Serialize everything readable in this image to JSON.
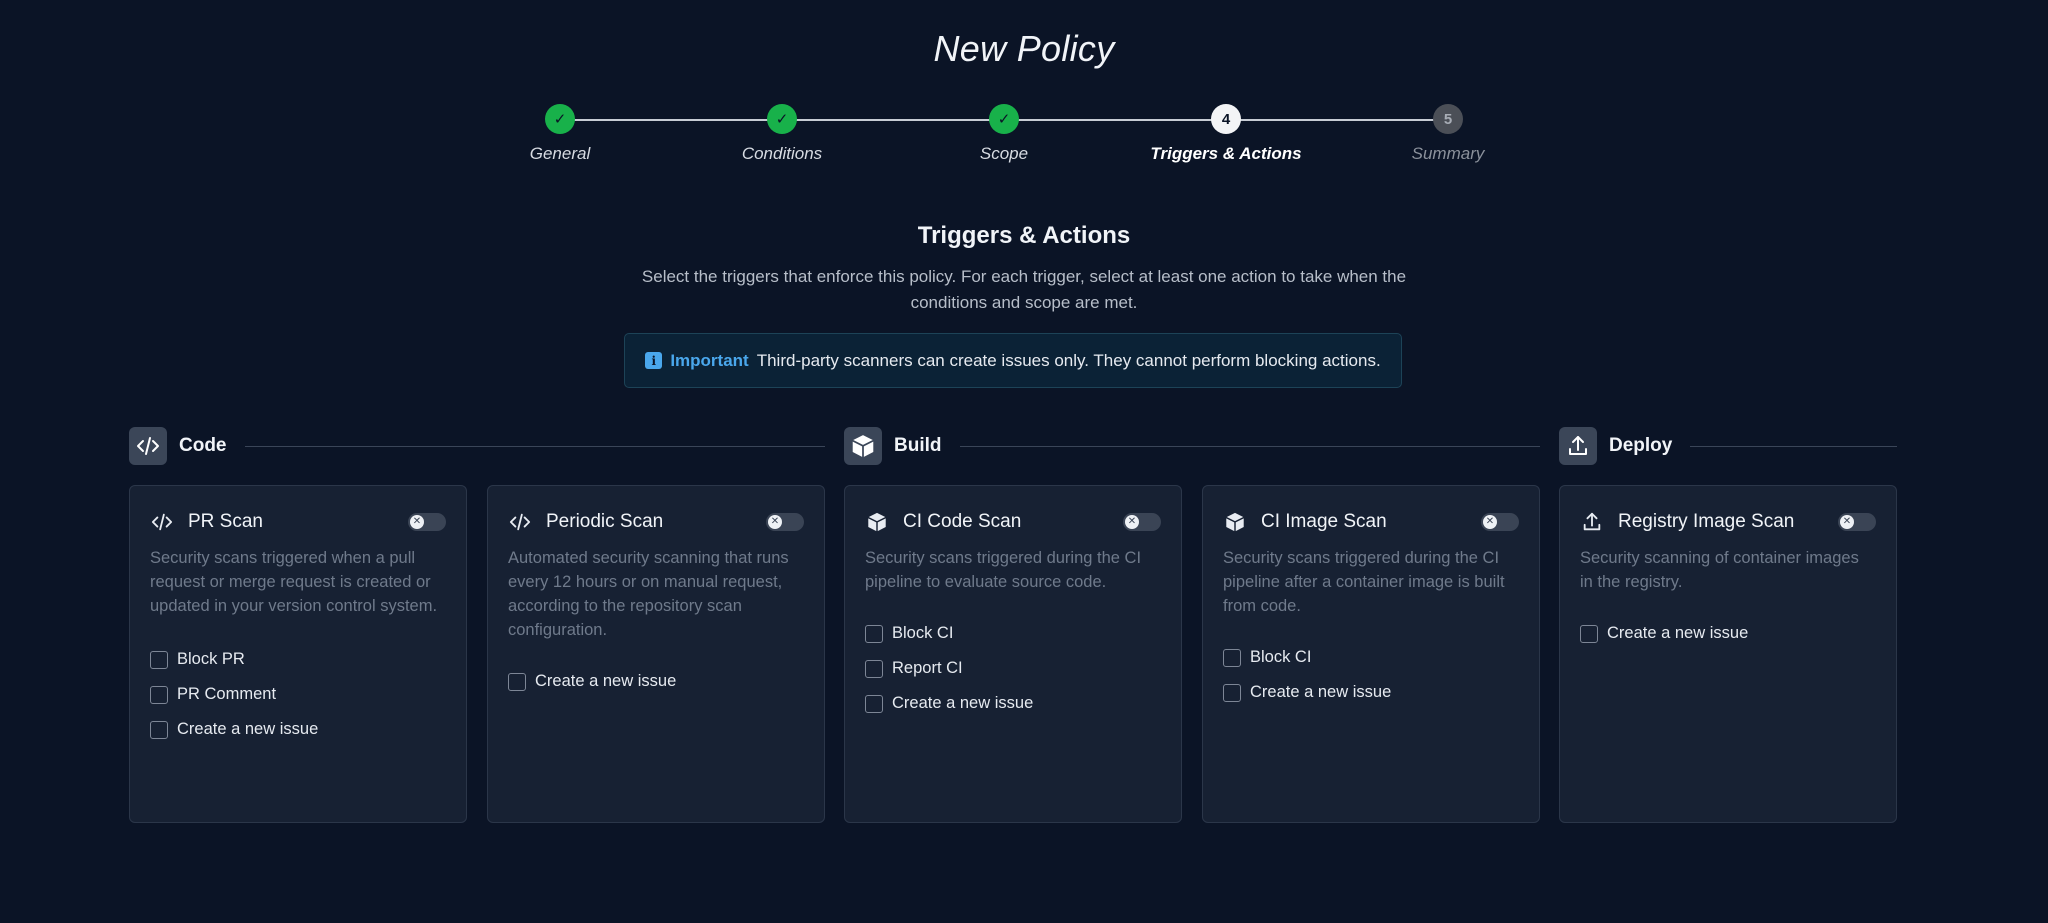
{
  "page": {
    "title": "New Policy"
  },
  "stepper": {
    "steps": [
      {
        "label": "General",
        "state": "done",
        "marker": "✓"
      },
      {
        "label": "Conditions",
        "state": "done",
        "marker": "✓"
      },
      {
        "label": "Scope",
        "state": "done",
        "marker": "✓"
      },
      {
        "label": "Triggers & Actions",
        "state": "active",
        "marker": "4"
      },
      {
        "label": "Summary",
        "state": "pending",
        "marker": "5"
      }
    ]
  },
  "section": {
    "title": "Triggers & Actions",
    "description": "Select the triggers that enforce this policy. For each trigger, select at least one action to take when the conditions and scope are met."
  },
  "notice": {
    "icon": "info-icon",
    "icon_glyph": "i",
    "label": "Important",
    "text": "Third-party scanners can create issues only. They cannot perform blocking actions."
  },
  "groups": {
    "code": {
      "label": "Code",
      "icon": "code-icon"
    },
    "build": {
      "label": "Build",
      "icon": "package-icon"
    },
    "deploy": {
      "label": "Deploy",
      "icon": "upload-icon"
    }
  },
  "cards": {
    "pr_scan": {
      "title": "PR Scan",
      "icon": "code-icon",
      "enabled": false,
      "toggle_glyph": "✕",
      "description": "Security scans triggered when a pull request or merge request is created or updated in your version control system.",
      "options": [
        "Block PR",
        "PR Comment",
        "Create a new issue"
      ]
    },
    "periodic_scan": {
      "title": "Periodic Scan",
      "icon": "code-icon",
      "enabled": false,
      "toggle_glyph": "✕",
      "description": "Automated security scanning that runs every 12 hours or on manual request, according to the repository scan configuration.",
      "options": [
        "Create a new issue"
      ]
    },
    "ci_code_scan": {
      "title": "CI Code Scan",
      "icon": "package-icon",
      "enabled": false,
      "toggle_glyph": "✕",
      "description": "Security scans triggered during the CI pipeline to evaluate source code.",
      "options": [
        "Block CI",
        "Report CI",
        "Create a new issue"
      ]
    },
    "ci_image_scan": {
      "title": "CI Image Scan",
      "icon": "package-icon",
      "enabled": false,
      "toggle_glyph": "✕",
      "description": "Security scans triggered during the CI pipeline after a container image is built from code.",
      "options": [
        "Block CI",
        "Create a new issue"
      ]
    },
    "registry_image_scan": {
      "title": "Registry Image Scan",
      "icon": "upload-icon",
      "enabled": false,
      "toggle_glyph": "✕",
      "description": "Security scanning of container images in the registry.",
      "options": [
        "Create a new issue"
      ]
    }
  },
  "colors": {
    "background": "#0b1426",
    "card": "#172133",
    "done": "#18b14a",
    "accent": "#4aa7ec"
  }
}
